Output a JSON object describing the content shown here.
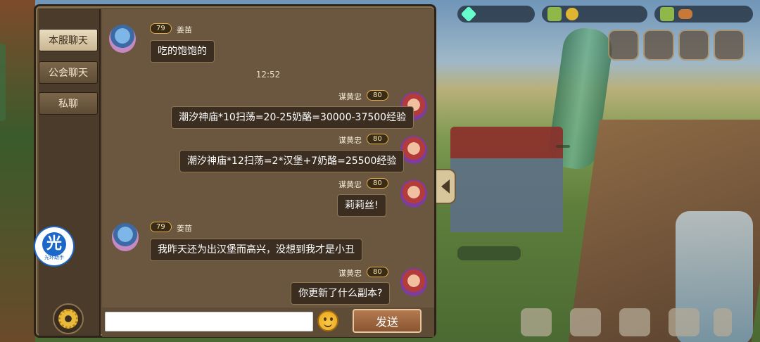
{
  "tabs": [
    {
      "label": "本服聊天",
      "active": true
    },
    {
      "label": "公会聊天",
      "active": false
    },
    {
      "label": "私聊",
      "active": false
    }
  ],
  "assistant_badge": {
    "glyph": "光",
    "label": "光环助手"
  },
  "messages": [
    {
      "side": "left",
      "level": "79",
      "name": "姜苗",
      "text": "吃的饱饱的"
    },
    {
      "side": "time",
      "text": "12:52"
    },
    {
      "side": "right",
      "level": "80",
      "name": "谋黄忠",
      "text": "潮汐神庙*10扫荡=20-25奶酪=30000-37500经验"
    },
    {
      "side": "right",
      "level": "80",
      "name": "谋黄忠",
      "text": "潮汐神庙*12扫荡=2*汉堡+7奶酪=25500经验"
    },
    {
      "side": "right",
      "level": "80",
      "name": "谋黄忠",
      "text": "莉莉丝!"
    },
    {
      "side": "left",
      "level": "79",
      "name": "姜苗",
      "text": "我昨天还为出汉堡而高兴，没想到我才是小丑"
    },
    {
      "side": "right",
      "level": "80",
      "name": "谋黄忠",
      "text": "你更新了什么副本?"
    }
  ],
  "input": {
    "value": "",
    "placeholder": ""
  },
  "send_label": "发送",
  "colors": {
    "panel": "#5e4c36",
    "bubble": "#3b2e21",
    "level_border": "#e0b04c",
    "active_tab": "#e9dcc0"
  }
}
